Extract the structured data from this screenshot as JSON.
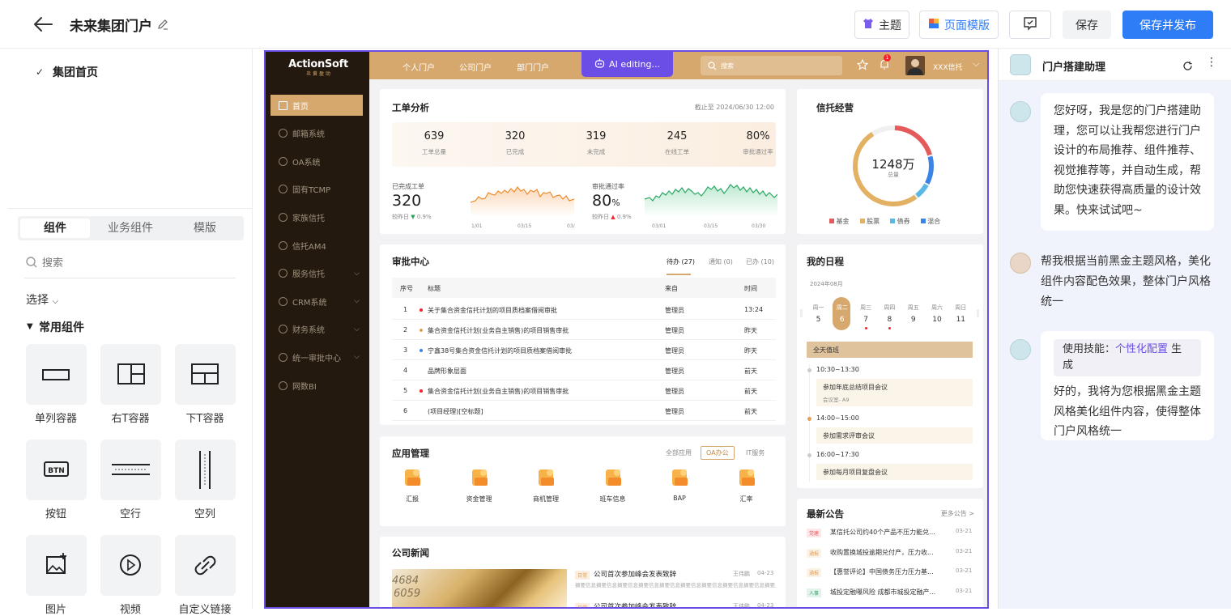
{
  "app": {
    "title": "未来集团门户"
  },
  "toolbar": {
    "theme": "主题",
    "template": "页面模版",
    "save": "保存",
    "publish": "保存并发布"
  },
  "tree": {
    "node": "集团首页"
  },
  "left": {
    "tabs": [
      "组件",
      "业务组件",
      "模版"
    ],
    "search_placeholder": "搜索",
    "select_label": "选择",
    "section": "常用组件",
    "components": [
      "单列容器",
      "右T容器",
      "下T容器",
      "按钮",
      "空行",
      "空列",
      "图片",
      "视频",
      "自定义链接"
    ]
  },
  "portal": {
    "logo": "ActionSoft",
    "logo_sub": "炎 黄 盈 动",
    "nav": [
      "个人门户",
      "公司门户",
      "部门门户"
    ],
    "ai_badge": "AI editing...",
    "search_placeholder": "搜索",
    "notif_count": "1",
    "user": "XXX信托",
    "menu": [
      "首页",
      "邮箱系统",
      "OA系统",
      "固有TCMP",
      "家族信托",
      "信托AM4",
      "服务信托",
      "CRM系统",
      "财务系统",
      "统一审批中心",
      "网数BI"
    ],
    "work": {
      "title": "工单分析",
      "date": "截止至 2024/06/30 12:00",
      "stats": [
        {
          "v": "639",
          "l": "工单总量"
        },
        {
          "v": "320",
          "l": "已完成"
        },
        {
          "v": "319",
          "l": "未完成"
        },
        {
          "v": "245",
          "l": "在线工单"
        },
        {
          "v": "80%",
          "l": "审批通过率"
        }
      ],
      "left_label": "已完成工单",
      "left_value": "320",
      "left_compare": "较昨日",
      "left_delta": "0.9%",
      "right_label": "审批通过率",
      "right_value": "80",
      "right_unit": "%",
      "right_compare": "较昨日",
      "right_delta": "0.9%",
      "ticks1": [
        "1/01",
        "03/15",
        "03/"
      ],
      "ticks2": [
        "03/01",
        "03/15",
        "03/30"
      ]
    },
    "trust": {
      "title": "信托经营",
      "total": "1248万",
      "total_label": "总量",
      "legend": [
        "基金",
        "股票",
        "债券",
        "混合"
      ]
    },
    "approval": {
      "title": "审批中心",
      "tabs": [
        "待办 (27)",
        "通知 (0)",
        "已办 (10)"
      ],
      "headers": [
        "序号",
        "标题",
        "来自",
        "时间"
      ],
      "rows": [
        {
          "n": "1",
          "t": "关于集合资金信托计划的项目质档案借阅审批",
          "f": "管理员",
          "d": "13:24"
        },
        {
          "n": "2",
          "t": "集合资金信托计划(业务自主销售)的项目销售审批",
          "f": "管理员",
          "d": "昨天"
        },
        {
          "n": "3",
          "t": "宁鑫38号集合资金信托计划的项目质档案借阅审批",
          "f": "管理员",
          "d": "昨天"
        },
        {
          "n": "4",
          "t": "品牌形象层面",
          "f": "管理员",
          "d": "前天"
        },
        {
          "n": "5",
          "t": "集合资金信托计划(业务自主销售)的项目销售审批",
          "f": "管理员",
          "d": "前天"
        },
        {
          "n": "6",
          "t": "(项目经理)[空标题]",
          "f": "管理员",
          "d": "前天"
        }
      ]
    },
    "schedule": {
      "title": "我的日程",
      "month": "2024年08月",
      "weekdays": [
        "周一",
        "周二",
        "周三",
        "周四",
        "周五",
        "周六",
        "周日"
      ],
      "days": [
        "5",
        "6",
        "7",
        "8",
        "9",
        "10",
        "11"
      ],
      "allday": "全天值班",
      "events": [
        {
          "time": "10:30~13:30",
          "title": "参加年底总结项目会议",
          "sub": "会议室- A9"
        },
        {
          "time": "14:00~15:00",
          "title": "参加需求评审会议",
          "sub": ""
        },
        {
          "time": "16:00~17:30",
          "title": "参加每月项目复盘会议",
          "sub": ""
        }
      ]
    },
    "apps": {
      "title": "应用管理",
      "tabs": [
        "全部应用",
        "OA办公",
        "IT服务"
      ],
      "items": [
        "汇报",
        "资金管理",
        "商机管理",
        "班车信息",
        "BAP",
        "汇率"
      ]
    },
    "notice": {
      "title": "最新公告",
      "more": "更多公告 >",
      "items": [
        {
          "tag": "党建",
          "text": "某信托公司约40个产品不压力能兑...",
          "date": "03-21"
        },
        {
          "tag": "通报",
          "text": "收购置换城投逾期兑付产，压力收...",
          "date": "03-21"
        },
        {
          "tag": "通报",
          "text": "【惠誉评论】中国债务压力压力基...",
          "date": "03-21"
        },
        {
          "tag": "人事",
          "text": "城投定融曝风险 成都市城投定融产...",
          "date": "03-21"
        }
      ]
    },
    "news": {
      "title": "公司新闻",
      "items": [
        {
          "tag": "日常",
          "title": "公司首次参加峰会发表致辞",
          "author": "王伟鹏",
          "date": "04-23",
          "summary": "摘要信息摘要信息摘要信息摘要信息摘要信息摘要信息摘要信息摘要信息摘要信息摘要息..."
        },
        {
          "tag": "日常",
          "title": "公司首次参加峰会发表致辞",
          "author": "王伟鹏",
          "date": "04-23",
          "summary": ""
        }
      ]
    }
  },
  "assistant": {
    "title": "门户搭建助理",
    "msg1": "您好呀，我是您的门户搭建助理，您可以让我帮您进行门户设计的布局推荐、组件推荐、视觉推荐等，并自动生成，帮助您快速获得高质量的设计效果。快来试试吧~",
    "user_msg": "帮我根据当前黑金主题风格，美化组件内容配色效果，整体门户风格统一",
    "skill_prefix": "使用技能：",
    "skill_name": "个性化配置",
    "skill_suffix": " 生成",
    "msg2": "好的，我将为您根据黑金主题风格美化组件内容，使得整体门户风格统一"
  },
  "colors": {
    "primary": "#2e7cf6",
    "gold": "#d7a86e",
    "dark": "#24190e",
    "accent_purple": "#6b4ee6"
  }
}
